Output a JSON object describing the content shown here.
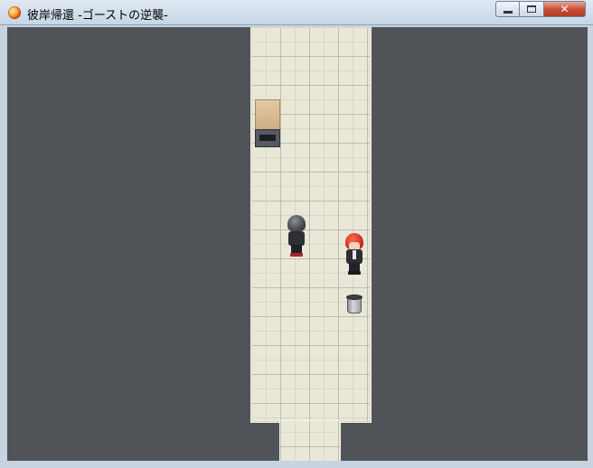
{
  "window": {
    "title": "彼岸帰還  -ゴーストの逆襲-",
    "controls": {
      "minimize": "minimize",
      "maximize": "maximize",
      "close": "✕"
    }
  },
  "scene": {
    "background_color": "#505459",
    "floor_color": "#e9e7d8",
    "objects": [
      {
        "name": "desk",
        "icon": "desk-terminal-icon"
      },
      {
        "name": "player",
        "icon": "gray-haired-character-sprite"
      },
      {
        "name": "npc",
        "icon": "red-haired-character-sprite"
      },
      {
        "name": "bucket",
        "icon": "bucket-icon"
      }
    ]
  }
}
